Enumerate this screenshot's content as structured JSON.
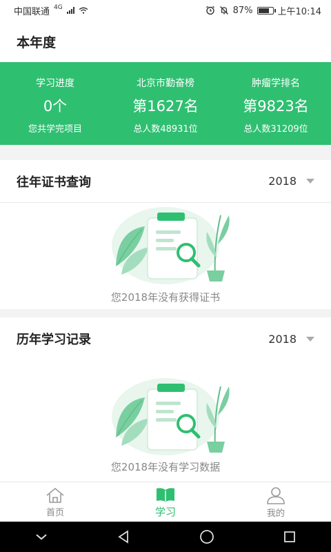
{
  "status_bar": {
    "carrier": "中国联通",
    "network": "4G",
    "battery_percent": "87%",
    "battery_level": 0.87,
    "time": "上午10:14"
  },
  "header": {
    "title": "本年度"
  },
  "stats": [
    {
      "label": "学习进度",
      "value": "0个",
      "sub": "您共学完项目"
    },
    {
      "label": "北京市勤奋榜",
      "value": "第1627名",
      "sub": "总人数48931位"
    },
    {
      "label": "肿瘤学排名",
      "value": "第9823名",
      "sub": "总人数31209位"
    }
  ],
  "certificates": {
    "title": "往年证书查询",
    "year": "2018",
    "empty_text": "您2018年没有获得证书"
  },
  "history": {
    "title": "历年学习记录",
    "year": "2018",
    "empty_text": "您2018年没有学习数据"
  },
  "bottom_nav": [
    {
      "label": "首页",
      "icon": "home-icon",
      "active": false
    },
    {
      "label": "学习",
      "icon": "book-icon",
      "active": true
    },
    {
      "label": "我的",
      "icon": "user-icon",
      "active": false
    }
  ],
  "colors": {
    "accent": "#2fbf71",
    "accent_light": "#dff3e8"
  }
}
